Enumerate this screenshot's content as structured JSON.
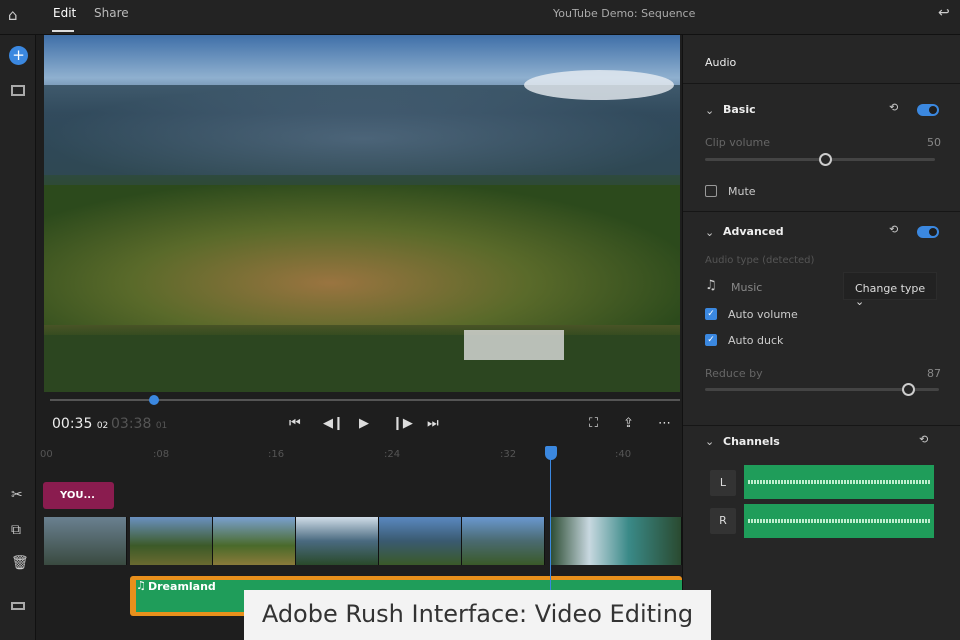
{
  "topbar": {
    "tabs": [
      "Edit",
      "Share"
    ],
    "title": "YouTube Demo: Sequence"
  },
  "player": {
    "current_time": "00:35",
    "current_frames": "02",
    "total_time": "03:38",
    "total_frames": "01",
    "progress_percent": 16
  },
  "timeline": {
    "ticks": [
      "00",
      ":08",
      ":16",
      ":24",
      ":32",
      ":40"
    ],
    "title_clip": "YOU...",
    "audio_clip": "Dreamland",
    "playhead_seconds": 35
  },
  "panel": {
    "header": "Audio",
    "basic": {
      "label": "Basic",
      "clip_volume_label": "Clip volume",
      "clip_volume": 50,
      "mute_label": "Mute",
      "mute": false
    },
    "advanced": {
      "label": "Advanced",
      "audio_type_label": "Audio type (detected)",
      "audio_type": "Music",
      "change_type": "Change type",
      "auto_volume": "Auto volume",
      "auto_duck": "Auto duck",
      "reduce_by_label": "Reduce by",
      "reduce_by": 87
    },
    "channels": {
      "label": "Channels",
      "left": "L",
      "right": "R"
    }
  },
  "caption": "Adobe Rush Interface: Video Editing",
  "colors": {
    "accent": "#3b88e0",
    "audio_clip": "#e8901c",
    "waveform": "#1f9d5a",
    "title_clip": "#8a1c4f"
  }
}
